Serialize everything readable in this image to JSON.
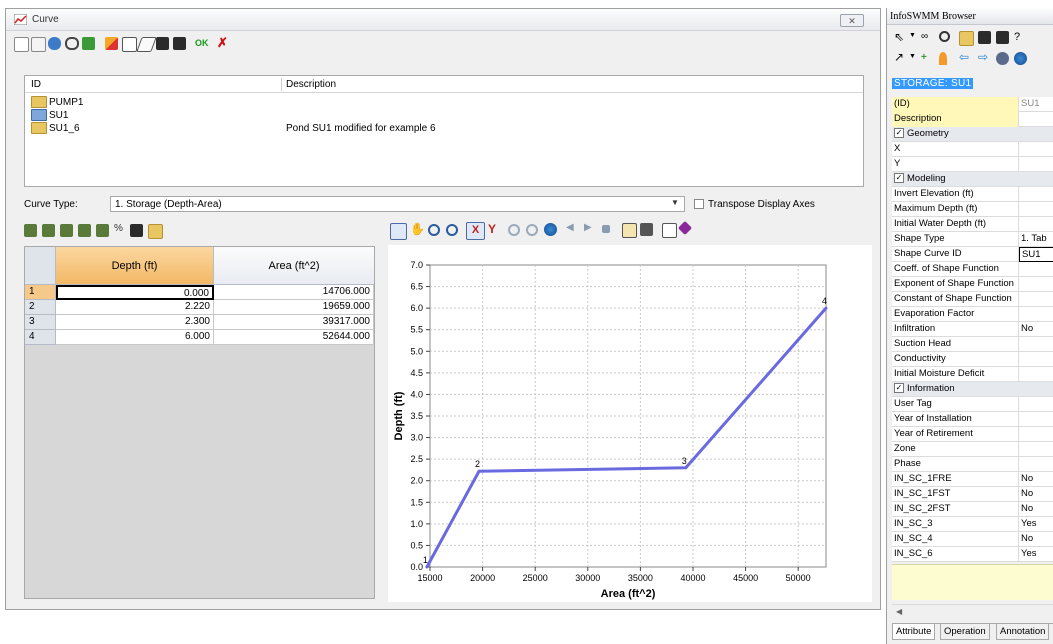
{
  "curve_window": {
    "title": "Curve",
    "toolbar_icons": [
      "new-curve-icon",
      "copy-curve-icon",
      "import-icon",
      "link-icon",
      "add-icon",
      "edit-icon",
      "duplicate-icon",
      "eraser-icon",
      "save-icon",
      "save-as-icon",
      "ok-icon",
      "cancel-icon"
    ],
    "list": {
      "headers": {
        "id": "ID",
        "description": "Description"
      },
      "rows": [
        {
          "id": "PUMP1",
          "description": "",
          "icon": "folder-icon"
        },
        {
          "id": "SU1",
          "description": "",
          "icon": "blue-folder-icon"
        },
        {
          "id": "SU1_6",
          "description": "Pond SU1 modified for example 6",
          "icon": "folder-icon"
        }
      ]
    },
    "curve_type": {
      "label": "Curve Type:",
      "value": "1. Storage (Depth-Area)",
      "transpose_label": "Transpose Display Axes"
    },
    "grid": {
      "headers": {
        "depth": "Depth (ft)",
        "area": "Area (ft^2)"
      },
      "rows": [
        {
          "n": "1",
          "depth": "0.000",
          "area": "14706.000"
        },
        {
          "n": "2",
          "depth": "2.220",
          "area": "19659.000"
        },
        {
          "n": "3",
          "depth": "2.300",
          "area": "39317.000"
        },
        {
          "n": "4",
          "depth": "6.000",
          "area": "52644.000"
        }
      ]
    }
  },
  "chart_data": {
    "type": "line",
    "x": [
      14706,
      19659,
      39317,
      52644
    ],
    "y": [
      0.0,
      2.22,
      2.3,
      6.0
    ],
    "point_labels": [
      "1",
      "2",
      "3",
      "4"
    ],
    "xlabel": "Area (ft^2)",
    "ylabel": "Depth (ft)",
    "xlim": [
      15000,
      52644
    ],
    "ylim": [
      0.0,
      7.0
    ],
    "xticks": [
      "15000",
      "20000",
      "25000",
      "30000",
      "35000",
      "40000",
      "45000",
      "50000"
    ],
    "yticks": [
      "0.0",
      "0.5",
      "1.0",
      "1.5",
      "2.0",
      "2.5",
      "3.0",
      "3.5",
      "4.0",
      "4.5",
      "5.0",
      "5.5",
      "6.0",
      "6.5",
      "7.0"
    ],
    "grid": true,
    "line_color": "#6a6ae0"
  },
  "browser": {
    "title": "InfoSWMM Browser",
    "storage_label": "STORAGE: SU1",
    "properties": [
      {
        "label": "(ID)",
        "value": "SU1",
        "section": false
      },
      {
        "label": "Description",
        "value": "",
        "section": false
      },
      {
        "label": "Geometry",
        "value": "",
        "section": true
      },
      {
        "label": "X",
        "value": "",
        "section": false
      },
      {
        "label": "Y",
        "value": "",
        "section": false
      },
      {
        "label": "Modeling",
        "value": "",
        "section": true
      },
      {
        "label": "Invert Elevation (ft)",
        "value": "",
        "section": false
      },
      {
        "label": "Maximum Depth (ft)",
        "value": "",
        "section": false
      },
      {
        "label": "Initial Water Depth (ft)",
        "value": "",
        "section": false
      },
      {
        "label": "Shape Type",
        "value": "1. Tab",
        "section": false
      },
      {
        "label": "Shape Curve ID",
        "value": "SU1",
        "section": false
      },
      {
        "label": "Coeff. of Shape Function",
        "value": "",
        "section": false
      },
      {
        "label": "Exponent of Shape Function",
        "value": "",
        "section": false
      },
      {
        "label": "Constant of Shape Function",
        "value": "",
        "section": false
      },
      {
        "label": "Evaporation Factor",
        "value": "",
        "section": false
      },
      {
        "label": "Infiltration",
        "value": "No",
        "section": false
      },
      {
        "label": "Suction Head",
        "value": "",
        "section": false
      },
      {
        "label": "Conductivity",
        "value": "",
        "section": false
      },
      {
        "label": "Initial Moisture Deficit",
        "value": "",
        "section": false
      },
      {
        "label": "Information",
        "value": "",
        "section": true
      },
      {
        "label": "User Tag",
        "value": "",
        "section": false
      },
      {
        "label": "Year of Installation",
        "value": "",
        "section": false
      },
      {
        "label": "Year of Retirement",
        "value": "",
        "section": false
      },
      {
        "label": "Zone",
        "value": "",
        "section": false
      },
      {
        "label": "Phase",
        "value": "",
        "section": false
      },
      {
        "label": "IN_SC_1FRE",
        "value": "No",
        "section": false
      },
      {
        "label": "IN_SC_1FST",
        "value": "No",
        "section": false
      },
      {
        "label": "IN_SC_2FST",
        "value": "No",
        "section": false
      },
      {
        "label": "IN_SC_3",
        "value": "Yes",
        "section": false
      },
      {
        "label": "IN_SC_4",
        "value": "No",
        "section": false
      },
      {
        "label": "IN_SC_6",
        "value": "Yes",
        "section": false
      }
    ],
    "tabs": [
      "Attribute",
      "Operation",
      "Annotation"
    ]
  }
}
